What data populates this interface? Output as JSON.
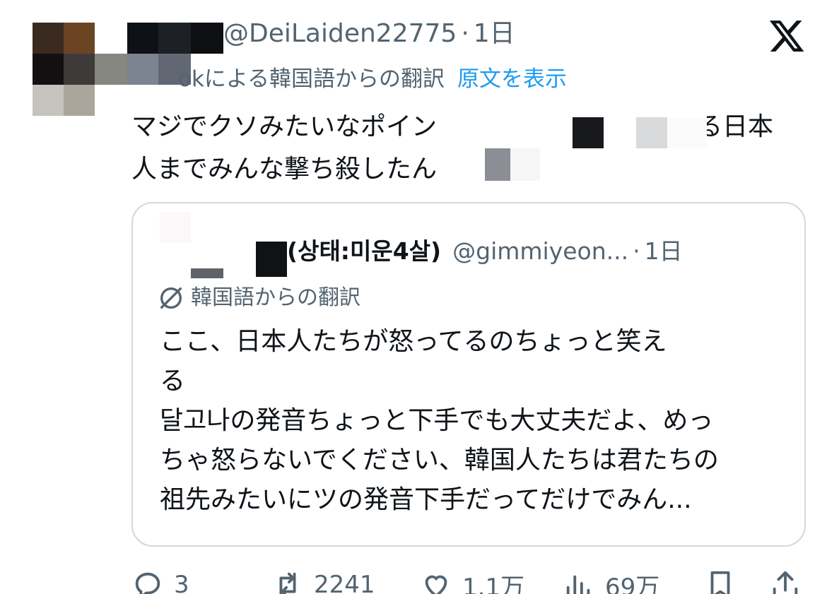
{
  "header": {
    "handle": "@DeiLaiden22775",
    "separator": "·",
    "time": "1日"
  },
  "translation": {
    "label_visible": "okによる韓国語からの翻訳",
    "show_original": "原文を表示"
  },
  "tweet": {
    "lines": [
      "マジでクソみたいなポイン",
      "る日本",
      "人までみんな撃ち殺したん"
    ]
  },
  "quote": {
    "name_visible": "(상태:미운4살)",
    "handle": "@gimmiyeon...",
    "separator": "·",
    "time": "1日",
    "translate_label": "韓国語からの翻訳",
    "lines": [
      "ここ、日本人たちが怒ってるのちょっと笑え",
      "る",
      "달고나の発音ちょっと下手でも大丈夫だよ、めっ",
      "ちゃ怒らないでください、韓国人たちは君たちの",
      "祖先みたいにツの発音下手だってだけでみん..."
    ]
  },
  "actions": {
    "replies": "3",
    "reposts": "2241",
    "likes": "1.1万",
    "views": "69万"
  },
  "icons": {
    "x_logo": "x-logo-icon",
    "translate": "translate-icon",
    "reply": "reply-icon",
    "repost": "repost-icon",
    "like": "heart-icon",
    "views": "views-icon",
    "bookmark": "bookmark-icon",
    "share": "share-icon"
  },
  "colors": {
    "text": "#0f1419",
    "secondary": "#536471",
    "link": "#1d9bf0",
    "border": "#cfd9de"
  }
}
